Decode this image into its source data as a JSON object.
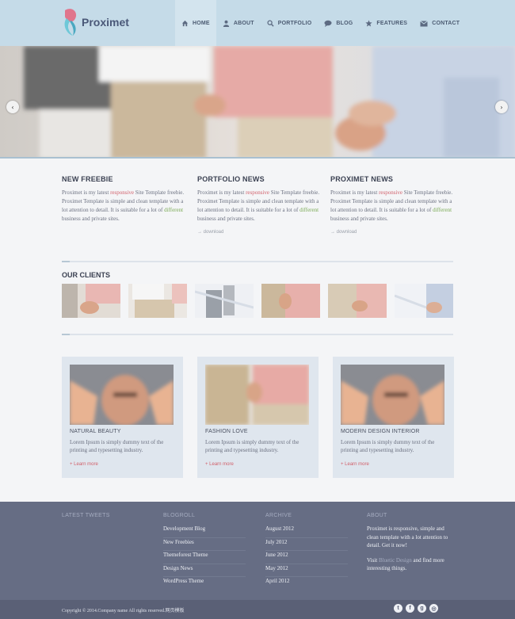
{
  "brand": {
    "name": "Proximet"
  },
  "nav": [
    {
      "label": "HOME",
      "icon": "home-icon"
    },
    {
      "label": "ABOUT",
      "icon": "user-icon"
    },
    {
      "label": "PORTFOLIO",
      "icon": "search-icon"
    },
    {
      "label": "BLOG",
      "icon": "chat-icon"
    },
    {
      "label": "FEATURES",
      "icon": "star-icon"
    },
    {
      "label": "CONTACT",
      "icon": "mail-icon"
    }
  ],
  "slider": {
    "prev": "‹",
    "next": "›"
  },
  "columns": [
    {
      "title": "NEW FREEBIE",
      "t1": "Proximet is my latest ",
      "red": "responsive",
      "t2": " Site Template freebie. Proximet Template is simple and clean template with a lot attention to detail. It is suitable for a lot of ",
      "green": "different",
      "t3": " business and private sites.",
      "link": ""
    },
    {
      "title": "PORTFOLIO NEWS",
      "t1": "Proximet is my latest ",
      "red": "responsive",
      "t2": " Site Template freebie. Proximet Template is simple and clean template with a lot attention to detail. It is suitable for a lot of ",
      "green": "different",
      "t3": " business and private sites.",
      "link": "→ download"
    },
    {
      "title": "PROXIMET NEWS",
      "t1": "Proximet is my latest ",
      "red": "responsive",
      "t2": " Site Template freebie. Proximet Template is simple and clean template with a lot attention to detail. It is suitable for a lot of ",
      "green": "different",
      "t3": " business and private sites.",
      "link": "→ download"
    }
  ],
  "clients": {
    "title": "OUR CLIENTS"
  },
  "features": [
    {
      "title": "NATURAL BEAUTY",
      "text": "Lorem Ipsum is simply dummy text of the printing and typesetting industry.",
      "more": "+ Learn more"
    },
    {
      "title": "FASHION LOVE",
      "text": "Lorem Ipsum is simply dummy text of the printing and typesetting industry.",
      "more": "+ Learn more"
    },
    {
      "title": "MODERN DESIGN INTERIOR",
      "text": "Lorem Ipsum is simply dummy text of the printing and typesetting industry.",
      "more": "+ Learn more"
    }
  ],
  "footer": {
    "tweets": {
      "title": "LATEST TWEETS"
    },
    "blogroll": {
      "title": "BLOGROLL",
      "links": [
        "Development Blog",
        "New Freebies",
        "Themeforest Theme",
        "Design News",
        "WordPress Theme"
      ]
    },
    "archive": {
      "title": "ARCHIVE",
      "links": [
        "August 2012",
        "July 2012",
        "June 2012",
        "May 2012",
        "April 2012"
      ]
    },
    "about": {
      "title": "ABOUT",
      "text": "Proximet is responsive, simple and clean template with a lot attention to detail. Get it now!",
      "visit_pre": "Visit ",
      "visit_link": "Bluetic Design",
      "visit_post": " and find more interesting things."
    },
    "copyright": "Copyright © 2014.Company name All rights reserved.网页模板",
    "socials": [
      {
        "icon": "twitter-icon",
        "glyph": "t"
      },
      {
        "icon": "facebook-icon",
        "glyph": "f"
      },
      {
        "icon": "googleplus-icon",
        "glyph": "g"
      },
      {
        "icon": "dribbble-icon",
        "glyph": "◎"
      }
    ]
  },
  "colors": {
    "header": "#c5dbe8",
    "footer": "#666d84",
    "accent_red": "#d1606b",
    "accent_green": "#7aaa55"
  }
}
